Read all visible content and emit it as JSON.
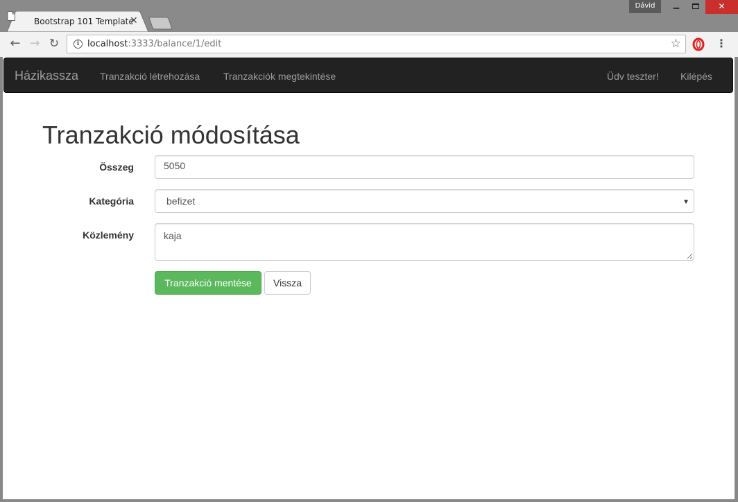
{
  "browser": {
    "profile_name": "Dávid",
    "tab_title": "Bootstrap 101 Template",
    "url_host": "localhost",
    "url_path": ":3333/balance/1/edit"
  },
  "navbar": {
    "brand": "Házikassza",
    "links": [
      {
        "label": "Tranzakció létrehozása"
      },
      {
        "label": "Tranzakciók megtekintése"
      }
    ],
    "welcome": "Üdv teszter!",
    "logout": "Kilépés"
  },
  "page": {
    "title": "Tranzakció módosítása"
  },
  "form": {
    "amount_label": "Összeg",
    "amount_value": "5050",
    "category_label": "Kategória",
    "category_value": "befizet",
    "note_label": "Közlemény",
    "note_value": "kaja",
    "save_button": "Tranzakció mentése",
    "back_button": "Vissza"
  },
  "colors": {
    "navbar_bg": "#222222",
    "success": "#5cb85c",
    "close_button": "#c9302c"
  }
}
